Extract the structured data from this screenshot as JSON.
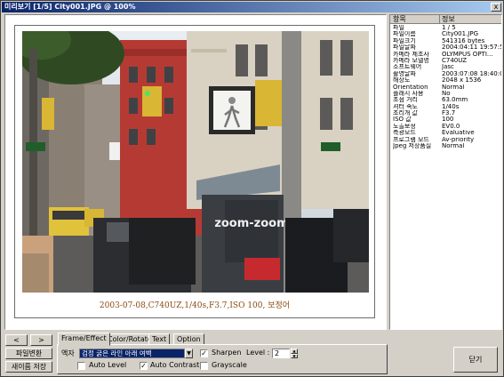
{
  "window": {
    "title": "미리보기 [1/5] City001.JPG @ 100%",
    "close": "x"
  },
  "preview": {
    "caption": "2003-07-08,C740UZ,1/40s,F3.7,ISO 100, 보정어"
  },
  "info": {
    "headers": [
      "항목",
      "정보"
    ],
    "rows": [
      [
        "파일",
        "1 / 5"
      ],
      [
        "파일이름",
        "City001.JPG"
      ],
      [
        "파일크기",
        "541316 bytes"
      ],
      [
        "파일날짜",
        "2004:04:11 19:57:50"
      ],
      [
        "카메라 제조사",
        "OLYMPUS OPTI..."
      ],
      [
        "카메라 모델명",
        "C740UZ"
      ],
      [
        "소프트웨어",
        "Jasc"
      ],
      [
        "촬영날짜",
        "2003:07:08 18:40:08"
      ],
      [
        "해상도",
        "2048 x 1536"
      ],
      [
        "Orientation",
        "Normal"
      ],
      [
        "플래시 사용",
        "No"
      ],
      [
        "초점 거리",
        "63.0mm"
      ],
      [
        "셔터 속도",
        "1/40s"
      ],
      [
        "조리개 값",
        "F3.7"
      ],
      [
        "ISO 값",
        "100"
      ],
      [
        "노출보정",
        "EV0.0"
      ],
      [
        "측광모드",
        "Evaluative"
      ],
      [
        "프로그램 모드",
        "Av-priority"
      ],
      [
        "Jpeg 저장품질",
        "Normal"
      ]
    ]
  },
  "nav": {
    "prev": "<",
    "next": ">",
    "convert": "파일변환",
    "save_as": "새이름 저장"
  },
  "tabs": [
    "Frame/Effect",
    "Color/Rotate",
    "Text",
    "Option"
  ],
  "frame_effect": {
    "frame_label": "액자",
    "frame_value": "검정 굵은 라인 아래 여백",
    "sharpen_label": "Sharpen",
    "sharpen_checked": true,
    "level_label": "Level :",
    "level_value": "2",
    "auto_level_label": "Auto Level",
    "auto_level_checked": false,
    "auto_contrast_label": "Auto Contrast",
    "auto_contrast_checked": true,
    "grayscale_label": "Grayscale",
    "grayscale_checked": false
  },
  "close_button": "닫기",
  "sign": {
    "text": "zoom-zoom"
  },
  "colors": {
    "title_start": "#0a246a",
    "title_end": "#a6caf0",
    "caption": "#8a4b10",
    "selection": "#0a246a"
  }
}
